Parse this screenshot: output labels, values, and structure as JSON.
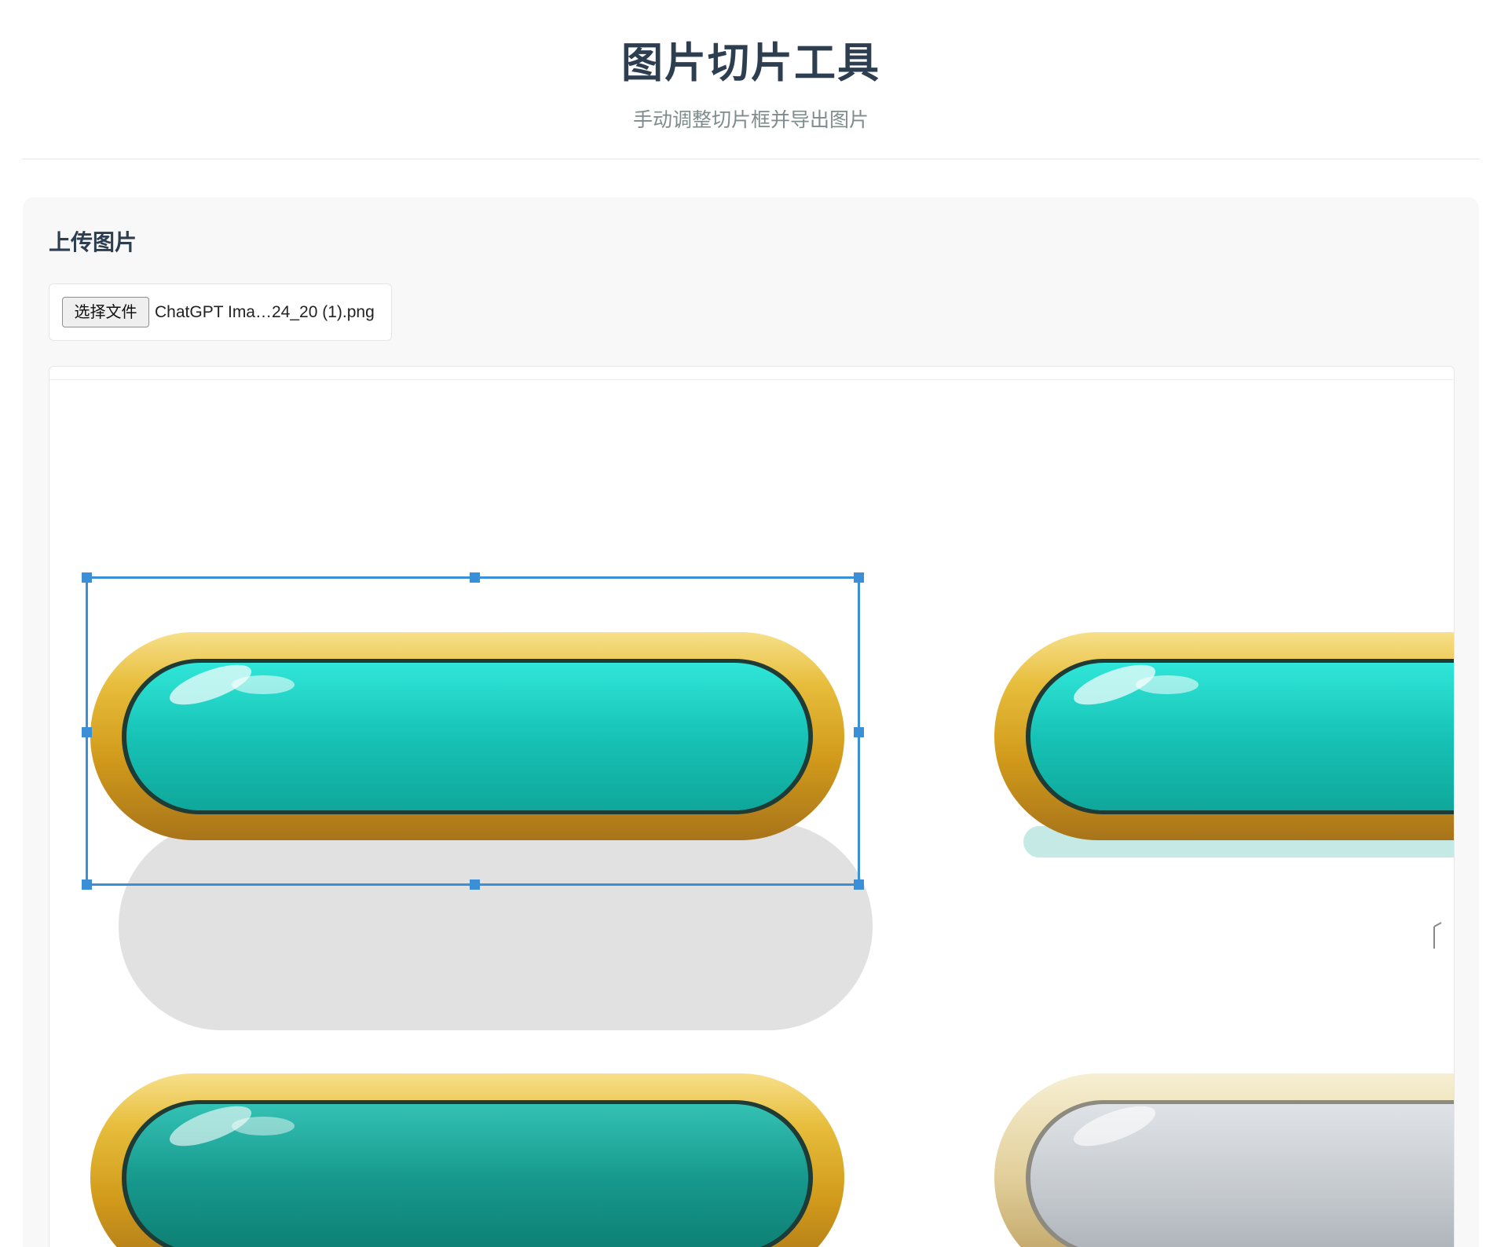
{
  "header": {
    "title": "图片切片工具",
    "subtitle": "手动调整切片框并导出图片"
  },
  "upload": {
    "section_title": "上传图片",
    "choose_button_label": "选择文件",
    "file_name": "ChatGPT Ima…24_20 (1).png"
  },
  "colors": {
    "accent": "#3b8fd6",
    "gold": "#d9a520",
    "teal": "#16c9bd",
    "dark_teal": "#15a394",
    "silver": "#c7ccd1"
  },
  "icons": {
    "handle": "resize-handle-icon"
  }
}
